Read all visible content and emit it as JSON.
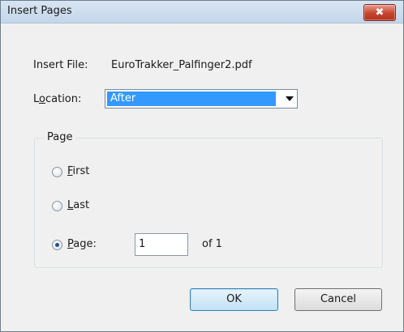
{
  "window": {
    "title": "Insert Pages",
    "close_label": "✖"
  },
  "insert_file": {
    "label": "Insert File:",
    "value": "EuroTrakker_Palfinger2.pdf"
  },
  "location": {
    "label_prefix": "L",
    "label_accel": "o",
    "label_rest": "cation:",
    "selected": "After"
  },
  "page_group": {
    "title": "Page",
    "first": {
      "accel": "F",
      "rest": "irst",
      "checked": false
    },
    "last": {
      "accel": "L",
      "rest": "ast",
      "checked": false
    },
    "page": {
      "accel": "P",
      "rest": "age:",
      "checked": true
    },
    "page_number": "1",
    "of_text": "of 1"
  },
  "buttons": {
    "ok": "OK",
    "cancel": "Cancel"
  }
}
